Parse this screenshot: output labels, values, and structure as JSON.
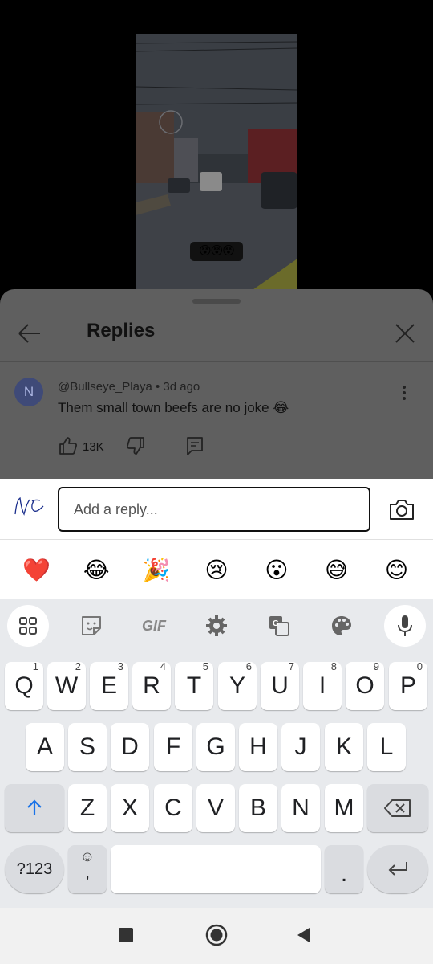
{
  "video": {
    "caption_emojis": "😵😵😵"
  },
  "panel": {
    "title": "Replies",
    "comment": {
      "avatar_letter": "N",
      "author": "@Bullseye_Playa",
      "age": "3d ago",
      "text": "Them small town beefs are no joke 😂",
      "like_count": "13K"
    }
  },
  "reply_bar": {
    "placeholder": "Add a reply..."
  },
  "emoji_bar": [
    "❤️",
    "😂",
    "🎉",
    "😢",
    "😮",
    "😅",
    "😊"
  ],
  "keyboard": {
    "row1": [
      {
        "label": "Q",
        "hint": "1"
      },
      {
        "label": "W",
        "hint": "2"
      },
      {
        "label": "E",
        "hint": "3"
      },
      {
        "label": "R",
        "hint": "4"
      },
      {
        "label": "T",
        "hint": "5"
      },
      {
        "label": "Y",
        "hint": "6"
      },
      {
        "label": "U",
        "hint": "7"
      },
      {
        "label": "I",
        "hint": "8"
      },
      {
        "label": "O",
        "hint": "9"
      },
      {
        "label": "P",
        "hint": "0"
      }
    ],
    "row2": [
      "A",
      "S",
      "D",
      "F",
      "G",
      "H",
      "J",
      "K",
      "L"
    ],
    "row3": [
      "Z",
      "X",
      "C",
      "V",
      "B",
      "N",
      "M"
    ],
    "numbers_key": "?123",
    "comma_key": ",",
    "emoji_glyph": "☺",
    "period_key": ".",
    "gif_label": "GIF"
  },
  "colors": {
    "accent": "#1a73e8",
    "panel_dim": "#5f5f5f",
    "keyboard_bg": "#e8eaed"
  }
}
